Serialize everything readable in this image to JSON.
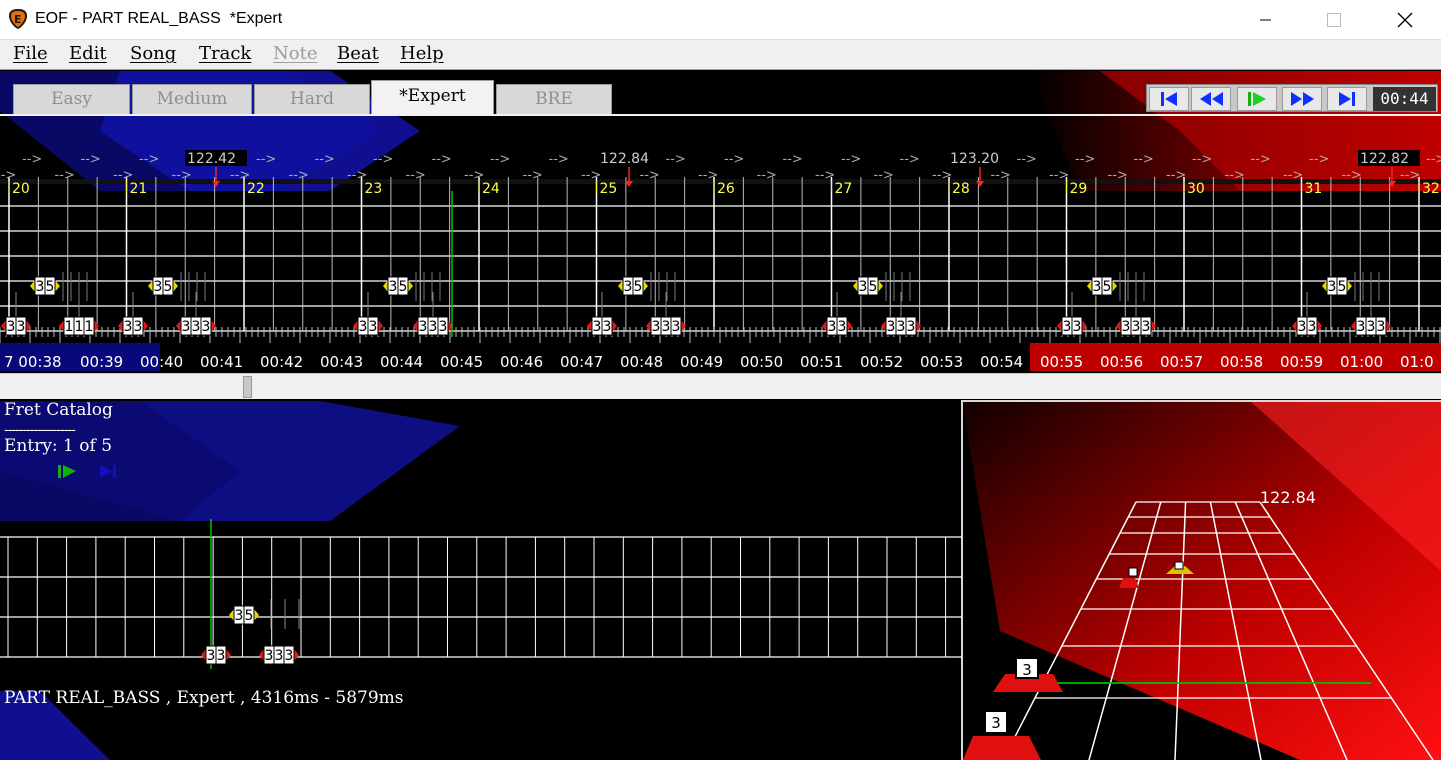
{
  "window": {
    "title": "EOF - PART REAL_BASS  *Expert",
    "icon": "eof-guitar-pick-icon"
  },
  "menu": [
    "File",
    "Edit",
    "Song",
    "Track",
    "Note",
    "Beat",
    "Help"
  ],
  "menu_disabled": [
    "Note"
  ],
  "tabs": [
    "Easy",
    "Medium",
    "Hard",
    "*Expert",
    "BRE"
  ],
  "active_tab": "*Expert",
  "transport": {
    "buttons": [
      "skip-to-start",
      "rewind",
      "play",
      "fast-forward",
      "skip-to-end"
    ],
    "time": "00:44"
  },
  "piano_roll": {
    "arrow": "-->",
    "bpm_labels": [
      "122.42",
      "122.84",
      "123.20",
      "122.82"
    ],
    "measures": [
      "20",
      "21",
      "22",
      "23",
      "24",
      "25",
      "26",
      "27",
      "28",
      "29",
      "30",
      "31",
      "32"
    ],
    "timestamps": [
      "7 00:38",
      "00:39",
      "00:40",
      "00:41",
      "00:42",
      "00:43",
      "00:44",
      "00:45",
      "00:46",
      "00:47",
      "00:48",
      "00:49",
      "00:50",
      "00:51",
      "00:52",
      "00:53",
      "00:54",
      "00:55",
      "00:56",
      "00:57",
      "00:58",
      "00:59",
      "01:00",
      "01:0"
    ],
    "notes": [
      {
        "frets": [
          "3",
          "3"
        ]
      },
      {
        "frets": [
          "1",
          "1",
          "1"
        ]
      },
      {
        "frets": [
          "3",
          "3"
        ]
      },
      {
        "frets": [
          "3",
          "3",
          "3"
        ]
      },
      {
        "frets": [
          "3",
          "5"
        ]
      },
      {
        "frets": [
          "3",
          "5"
        ]
      }
    ]
  },
  "fret_catalog": {
    "title": "Fret Catalog",
    "separator": "-------------------",
    "entry": "Entry: 1 of 5"
  },
  "catalog_view": {
    "chord_upper": [
      "3",
      "5"
    ],
    "chord_lower_a": [
      "3",
      "3"
    ],
    "chord_lower_b": [
      "3",
      "3",
      "3"
    ]
  },
  "status": "PART REAL_BASS , Expert , 4316ms - 5879ms",
  "highway_3d": {
    "bpm": "122.84",
    "gems": [
      "3",
      "3"
    ]
  },
  "colors": {
    "note_red": "#e01818",
    "note_yellow": "#e8d800",
    "marker": "#ffff00",
    "timebar": "#c00000",
    "playline": "#00c000"
  }
}
